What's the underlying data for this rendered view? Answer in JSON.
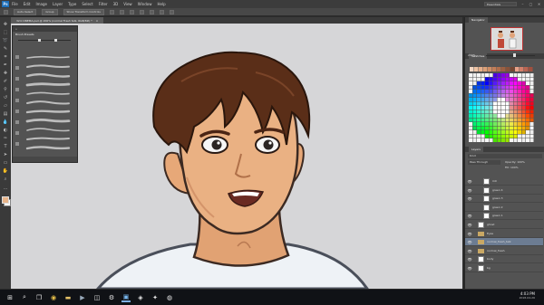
{
  "app": {
    "logo": "Ps",
    "menu": [
      "File",
      "Edit",
      "Image",
      "Layer",
      "Type",
      "Select",
      "Filter",
      "3D",
      "View",
      "Window",
      "Help"
    ],
    "workspace": "Essentials"
  },
  "options_bar": {
    "auto_select_label": "Auto-Select",
    "group_label": "Group",
    "transform_label": "Show Transform Controls"
  },
  "document": {
    "tab_title": "324 CINEMA.psd @ 200% (normal Fresh talk, RGB/8#) *",
    "close_glyph": "×"
  },
  "brush_panel": {
    "title": "Brush Presets",
    "brush_count": 11
  },
  "navigator": {
    "tab": "Navigator",
    "zoom": "200%"
  },
  "swatches": {
    "tab": "Swatches"
  },
  "layers": {
    "tab": "Layers",
    "kind_filter": "Kind",
    "blend_mode": "Pass Through",
    "opacity_label": "Opacity:",
    "opacity": "100%",
    "fill_label": "Fill:",
    "fill": "100%",
    "items": [
      {
        "name": "m0",
        "type": "layer",
        "visible": true,
        "indent": true
      },
      {
        "name": "green 4",
        "type": "layer",
        "visible": true,
        "indent": true
      },
      {
        "name": "green 3",
        "type": "layer",
        "visible": true,
        "indent": true
      },
      {
        "name": "green 2",
        "type": "layer",
        "visible": false,
        "indent": true
      },
      {
        "name": "green 1",
        "type": "layer",
        "visible": true,
        "indent": true
      },
      {
        "name": "ghost",
        "type": "layer",
        "visible": true,
        "indent": false
      },
      {
        "name": "Eyes",
        "type": "folder",
        "visible": true,
        "indent": false
      },
      {
        "name": "normal_fresh_talk",
        "type": "folder",
        "visible": true,
        "indent": false,
        "selected": true
      },
      {
        "name": "normal_fresh",
        "type": "folder",
        "visible": true,
        "indent": false
      },
      {
        "name": "body",
        "type": "layer",
        "visible": true,
        "indent": false
      },
      {
        "name": "bg",
        "type": "layer",
        "visible": true,
        "indent": false
      }
    ]
  },
  "taskbar": {
    "time": "4:03 PM",
    "date": "2018-04-26"
  },
  "colors": {
    "skin": "#eab183",
    "hair": "#5a2e18",
    "shirt": "#eef2f6",
    "canvas_bg": "#d6d6d8"
  }
}
